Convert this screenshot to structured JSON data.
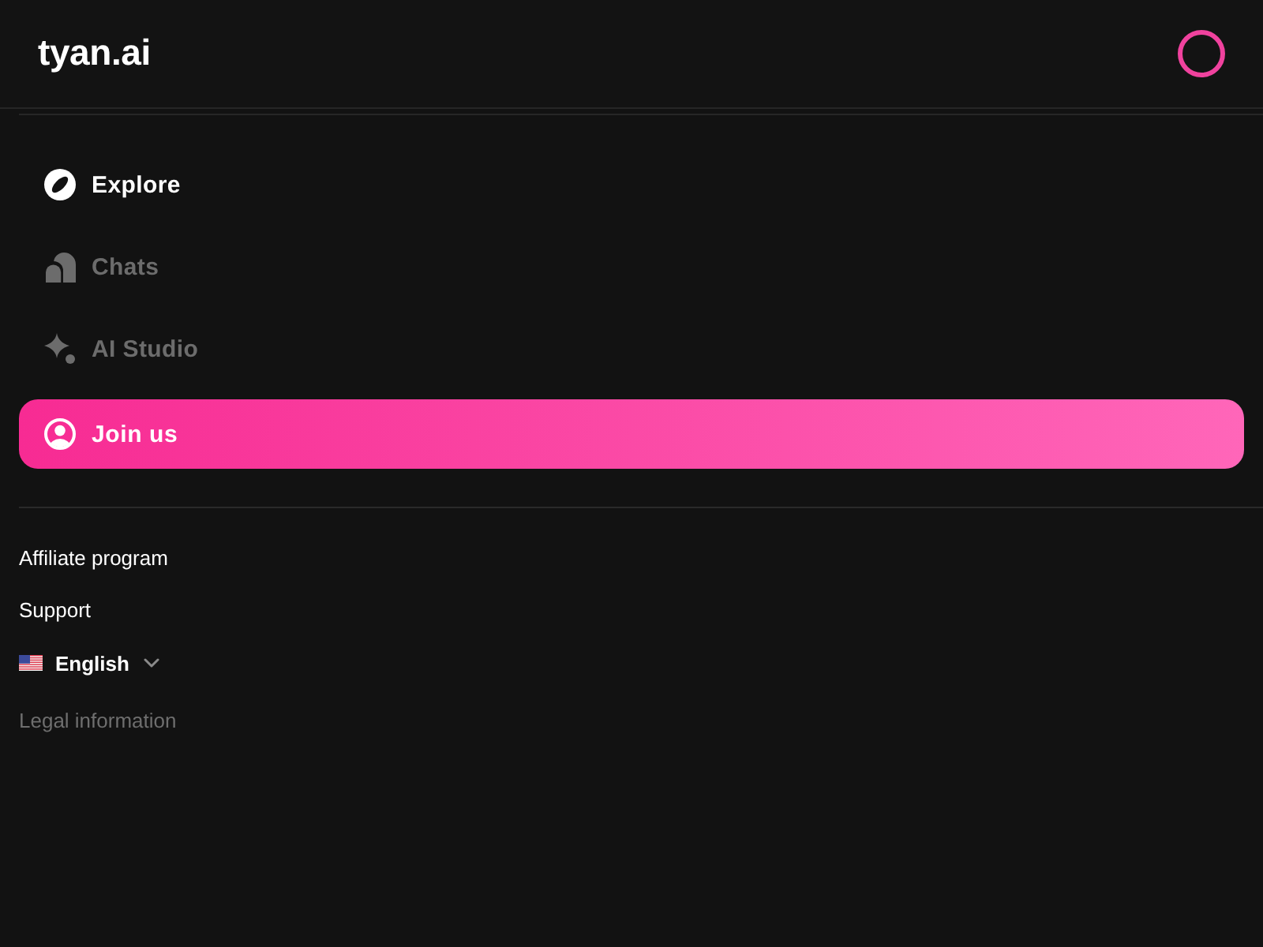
{
  "header": {
    "logo": "tyan.ai"
  },
  "nav": [
    {
      "label": "Explore",
      "kind": "explore",
      "selected": true
    },
    {
      "label": "Chats",
      "kind": "chats",
      "selected": false
    },
    {
      "label": "AI Studio",
      "kind": "studio",
      "selected": false
    }
  ],
  "join_button": {
    "label": "Join us"
  },
  "links": [
    {
      "label": "Affiliate program"
    },
    {
      "label": "Support"
    }
  ],
  "language": {
    "label": "English"
  },
  "legal": {
    "label": "Legal information"
  }
}
